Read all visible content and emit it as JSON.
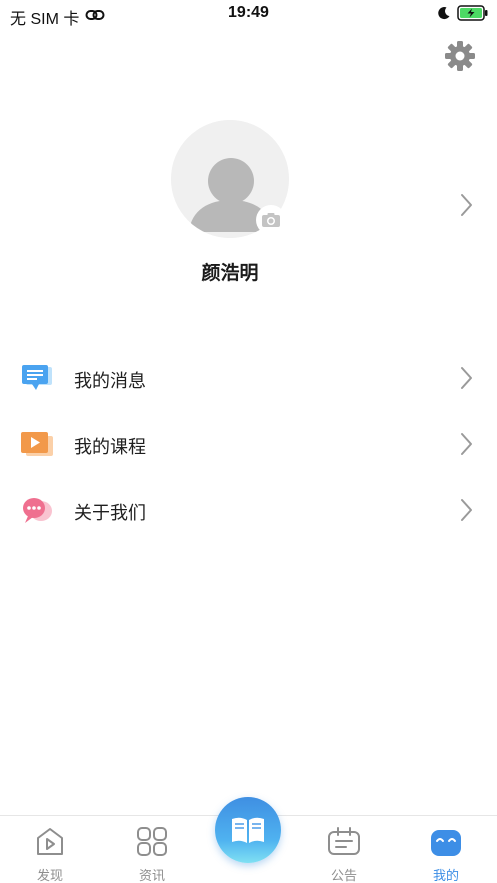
{
  "status_bar": {
    "carrier": "无 SIM 卡",
    "time": "19:49",
    "link_icon": "link-icon",
    "moon_icon": "moon-icon",
    "battery_icon": "battery-charging-icon"
  },
  "header": {
    "settings_icon": "gear-icon"
  },
  "profile": {
    "name": "颜浩明",
    "avatar_icon": "avatar-placeholder-icon",
    "camera_icon": "camera-icon"
  },
  "menu": {
    "items": [
      {
        "label": "我的消息",
        "icon": "message-icon",
        "color": "#4aa3f0"
      },
      {
        "label": "我的课程",
        "icon": "course-icon",
        "color": "#f2994a"
      },
      {
        "label": "关于我们",
        "icon": "about-icon",
        "color": "#ef6f8f"
      }
    ]
  },
  "tab_bar": {
    "tabs": [
      {
        "label": "发现",
        "icon": "discover-icon"
      },
      {
        "label": "资讯",
        "icon": "news-grid-icon"
      },
      {
        "label": "",
        "icon": "book-icon"
      },
      {
        "label": "公告",
        "icon": "notice-icon"
      },
      {
        "label": "我的",
        "icon": "profile-face-icon",
        "active": true
      }
    ],
    "active_color": "#3d8ee6",
    "inactive_color": "#8e8e8e"
  }
}
